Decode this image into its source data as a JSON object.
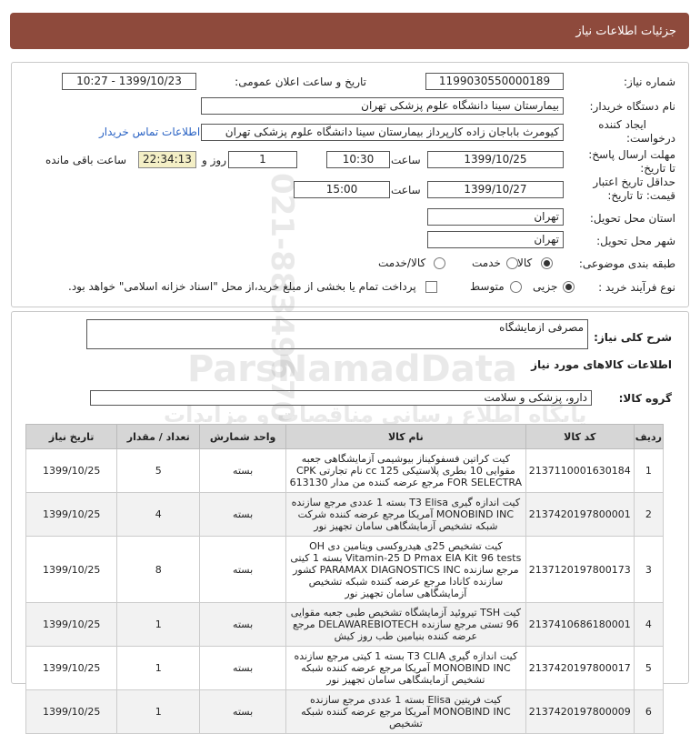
{
  "header": {
    "title": "جزئیات اطلاعات نیاز"
  },
  "details": {
    "need_number_label": "شماره نیاز:",
    "need_number": "1199030550000189",
    "announce_label": "تاریخ و ساعت اعلان عمومی:",
    "announce_value": "1399/10/23 - 10:27",
    "buyer_label": "نام دستگاه خریدار:",
    "buyer_value": "بیمارستان سینا دانشگاه علوم پزشکی تهران",
    "creator_label_1": "ایجاد کننده",
    "creator_label_2": "درخواست:",
    "creator_value": "کیومرث باباجان زاده  کارپرداز بیمارستان سینا دانشگاه علوم پزشکی تهران",
    "contact_link": "اطلاعات تماس خریدار",
    "deadline_label_1": "مهلت ارسال پاسخ:",
    "deadline_label_2": "تا تاریخ:",
    "deadline_date": "1399/10/25",
    "time_label": "ساعت",
    "deadline_time": "10:30",
    "days_value": "1",
    "days_label": "روز و",
    "remaining_time": "22:34:13",
    "remaining_label": "ساعت باقی مانده",
    "validity_label_1": "حداقل تاریخ اعتبار",
    "validity_label_2": "قیمت: تا تاریخ:",
    "validity_date": "1399/10/27",
    "validity_time_label": "ساعت",
    "validity_time": "15:00",
    "province_label": "استان محل تحویل:",
    "province_value": "تهران",
    "city_label": "شهر محل تحویل:",
    "city_value": "تهران",
    "category_label": "طبقه بندی موضوعی:",
    "category_options": [
      "کالا",
      "خدمت",
      "کالا/خدمت"
    ],
    "category_selected": "کالا",
    "process_label": "نوع فرآیند خرید :",
    "process_options": [
      "جزیی",
      "متوسط"
    ],
    "process_selected": "جزیی",
    "payment_note": "پرداخت تمام یا بخشی از مبلغ خرید،از محل \"اسناد خزانه اسلامی\" خواهد بود."
  },
  "description": {
    "label": "شرح کلی نیاز:",
    "value": "مصرفی ازمایشگاه"
  },
  "goods": {
    "section_title": "اطلاعات کالاهای مورد نیاز",
    "group_label": "گروه کالا:",
    "group_value": "دارو، پزشکی و سلامت",
    "columns": [
      "ردیف",
      "کد کالا",
      "نام کالا",
      "واحد شمارش",
      "تعداد / مقدار",
      "تاریخ نیاز"
    ],
    "rows": [
      {
        "index": "1",
        "code": "2137110001630184",
        "name": "کیت کراتین فسفوکیناز بیوشیمی آزمایشگاهی جعبه مقوایی 10 بطری پلاستیکی 125 cc نام تجارتی CPK FOR SELECTRA مرجع عرضه کننده من مدار 613130",
        "unit": "بسته",
        "qty": "5",
        "date": "1399/10/25"
      },
      {
        "index": "2",
        "code": "2137420197800001",
        "name": "کیت اندازه گیری T3 Elisa بسته 1 عددی مرجع سازنده MONOBIND INC آمریکا مرجع عرضه کننده شرکت شبکه تشخیص آزمایشگاهی سامان تجهیز نور",
        "unit": "بسته",
        "qty": "4",
        "date": "1399/10/25"
      },
      {
        "index": "3",
        "code": "2137120197800173",
        "name": "کیت تشخیص 25ی هیدروکسی ویتامین دی OH Vitamin-25 D Pmax EIA Kit 96 tests بسته 1 کیتی مرجع سازنده PARAMAX DIAGNOSTICS INC کشور سازنده کانادا مرجع عرضه کننده شبکه تشخیص آزمایشگاهی سامان تجهیز نور",
        "unit": "بسته",
        "qty": "8",
        "date": "1399/10/25"
      },
      {
        "index": "4",
        "code": "2137410686180001",
        "name": "کیت TSH تیروئید آزمایشگاه تشخیص طبی جعبه مقوایی 96 تستی مرجع سازنده DELAWAREBIOTECH مرجع عرضه کننده بنیامین طب روز کیش",
        "unit": "بسته",
        "qty": "1",
        "date": "1399/10/25"
      },
      {
        "index": "5",
        "code": "2137420197800017",
        "name": "کیت اندازه گیری T3 CLIA بسته 1 کیتی مرجع سازنده MONOBIND INC آمریکا مرجع عرضه کننده شبکه تشخیص آزمایشگاهی سامان تجهیز نور",
        "unit": "بسته",
        "qty": "1",
        "date": "1399/10/25"
      },
      {
        "index": "6",
        "code": "2137420197800009",
        "name": "کیت فریتین Elisa بسته 1 عددی مرجع سازنده MONOBIND INC آمریکا مرجع عرضه کننده شبکه تشخیص",
        "unit": "بسته",
        "qty": "1",
        "date": "1399/10/25"
      }
    ]
  },
  "watermark": {
    "brand": "ParsNamadData",
    "persian": "پایگاه اطلاع رسانی مناقصات و مزایدات",
    "phone": "021-88349670"
  }
}
